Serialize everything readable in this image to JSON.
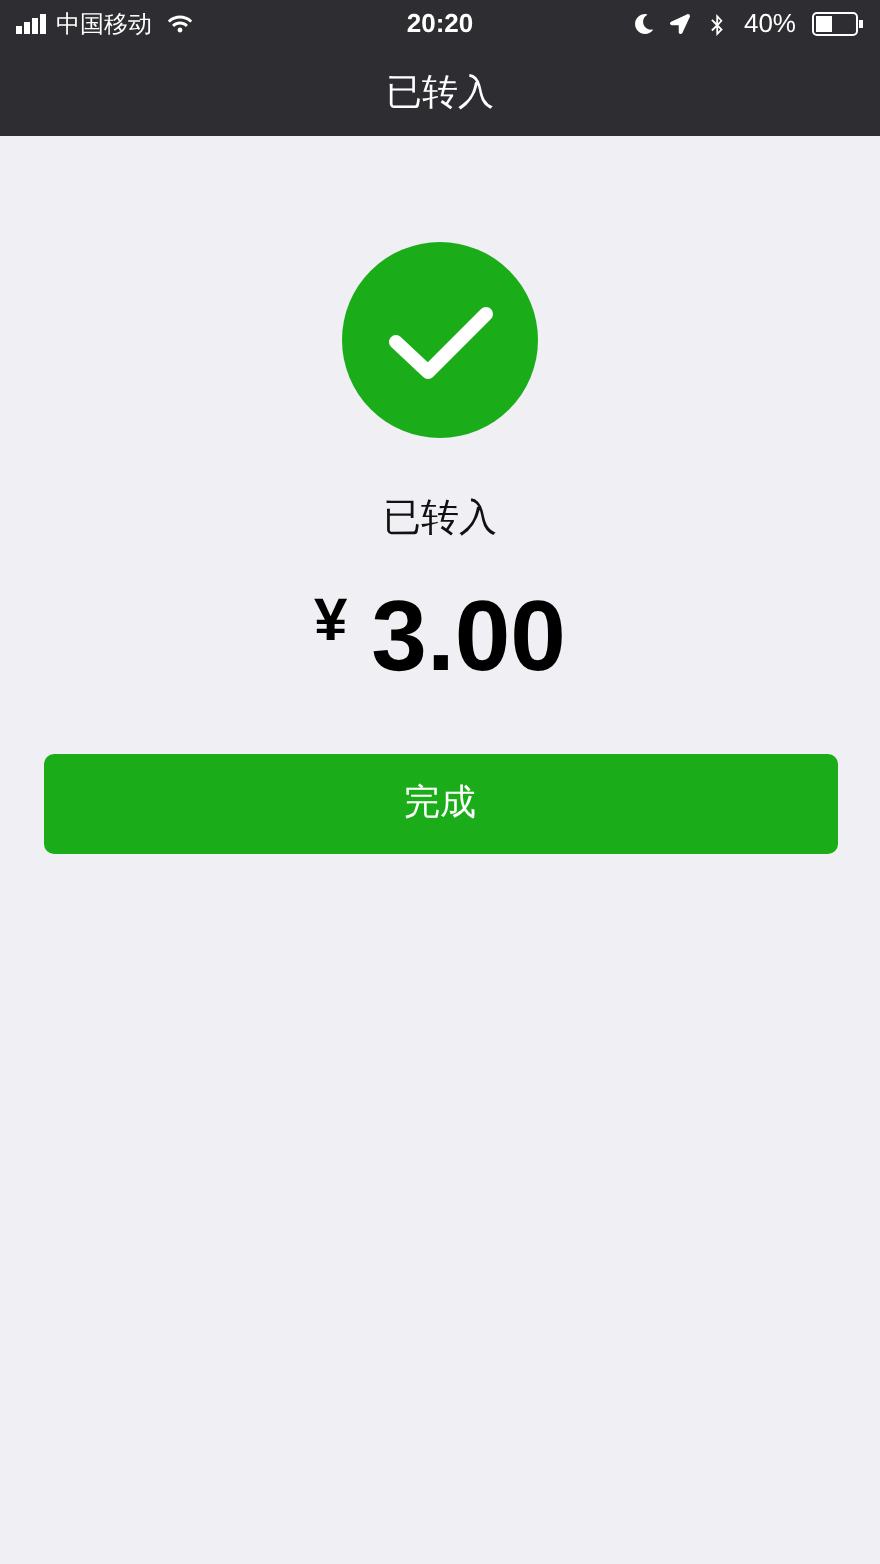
{
  "status_bar": {
    "carrier": "中国移动",
    "time": "20:20",
    "battery": "40%"
  },
  "nav_bar": {
    "title": "已转入"
  },
  "result": {
    "status": "已转入",
    "currency": "¥",
    "amount": "3.00"
  },
  "done_button": {
    "label": "完成"
  }
}
